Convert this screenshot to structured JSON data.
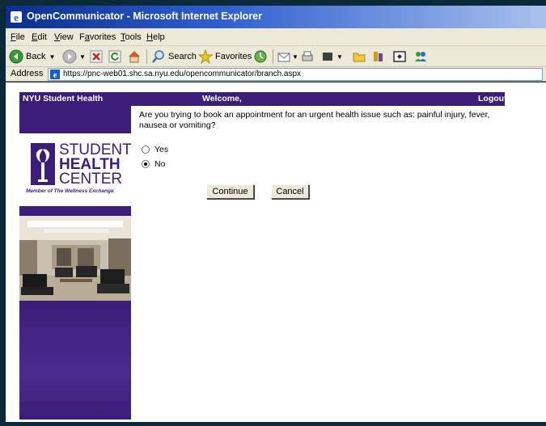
{
  "window": {
    "title": "OpenCommunicator - Microsoft Internet Explorer"
  },
  "menu": {
    "items": [
      {
        "label": "File",
        "accel": "F",
        "rest": "ile"
      },
      {
        "label": "Edit",
        "accel": "E",
        "rest": "dit"
      },
      {
        "label": "View",
        "accel": "V",
        "rest": "iew"
      },
      {
        "label": "Favorites",
        "accel": "a",
        "pre": "F",
        "rest": "vorites"
      },
      {
        "label": "Tools",
        "accel": "T",
        "rest": "ools"
      },
      {
        "label": "Help",
        "accel": "H",
        "rest": "elp"
      }
    ]
  },
  "toolbar": {
    "back_label": "Back",
    "search_label": "Search",
    "favorites_label": "Favorites"
  },
  "address": {
    "label": "Address",
    "url": "https://pnc-web01.shc.sa.nyu.edu/opencommunicator/branch.aspx"
  },
  "page": {
    "header_left": "NYU Student Health",
    "header_center": "Welcome,",
    "header_right": "Logout",
    "logo": {
      "line1": "STUDENT",
      "line2": "HEALTH",
      "line3": "CENTER",
      "tagline": "Member of The Wellness Exchange"
    },
    "question": "Are you trying to book an appointment for an urgent health issue such as: painful injury, fever, nausea or vomiting?",
    "options": [
      {
        "label": "Yes",
        "selected": false
      },
      {
        "label": "No",
        "selected": true
      }
    ],
    "continue_label": "Continue",
    "cancel_label": "Cancel"
  },
  "colors": {
    "nyu_purple": "#3b1e78",
    "titlebar_blue": "#0b2e8c",
    "chrome_gray": "#ece9d8"
  }
}
